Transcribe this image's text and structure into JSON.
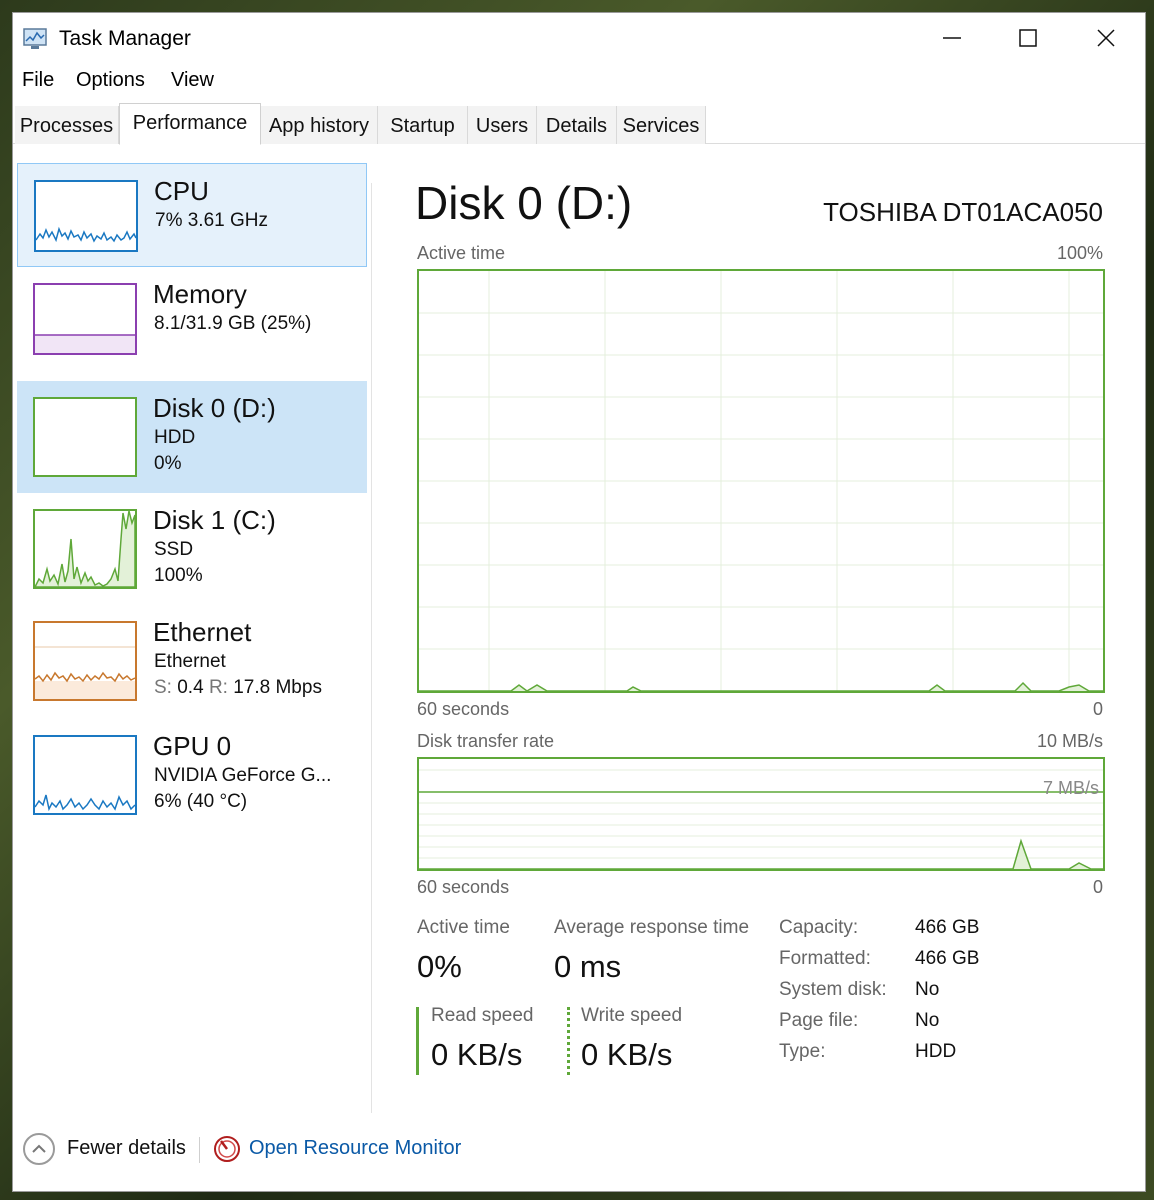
{
  "window": {
    "title": "Task Manager"
  },
  "menu": [
    "File",
    "Options",
    "View"
  ],
  "tabs": [
    "Processes",
    "Performance",
    "App history",
    "Startup",
    "Users",
    "Details",
    "Services"
  ],
  "active_tab": "Performance",
  "sidebar": [
    {
      "name": "CPU",
      "line1": "7%  3.61 GHz"
    },
    {
      "name": "Memory",
      "line1": "8.1/31.9 GB (25%)"
    },
    {
      "name": "Disk 0 (D:)",
      "line1": "HDD",
      "line2": "0%"
    },
    {
      "name": "Disk 1 (C:)",
      "line1": "SSD",
      "line2": "100%"
    },
    {
      "name": "Ethernet",
      "line1": "Ethernet",
      "line2_s_label": "S:",
      "line2_s_val": "0.4",
      "line2_r_label": "R:",
      "line2_r_val": "17.8 Mbps"
    },
    {
      "name": "GPU 0",
      "line1": "NVIDIA GeForce G...",
      "line2": "6%  (40 °C)"
    }
  ],
  "main": {
    "title": "Disk 0 (D:)",
    "device": "TOSHIBA DT01ACA050",
    "graph1": {
      "label": "Active time",
      "max": "100%",
      "time": "60 seconds",
      "min": "0"
    },
    "graph2": {
      "label": "Disk transfer rate",
      "max": "10 MB/s",
      "inner": "7 MB/s",
      "time": "60 seconds",
      "min": "0"
    },
    "stats": {
      "active_time_label": "Active time",
      "active_time": "0%",
      "avg_resp_label": "Average response time",
      "avg_resp": "0 ms",
      "read_label": "Read speed",
      "read": "0 KB/s",
      "write_label": "Write speed",
      "write": "0 KB/s"
    },
    "props": [
      {
        "label": "Capacity:",
        "value": "466 GB"
      },
      {
        "label": "Formatted:",
        "value": "466 GB"
      },
      {
        "label": "System disk:",
        "value": "No"
      },
      {
        "label": "Page file:",
        "value": "No"
      },
      {
        "label": "Type:",
        "value": "HDD"
      }
    ]
  },
  "footer": {
    "fewer": "Fewer details",
    "resource_monitor": "Open Resource Monitor"
  },
  "colors": {
    "disk_green": "#5fa839",
    "cpu_blue": "#1a78c2",
    "memory_purple": "#8b3fb0",
    "ethernet_orange": "#c8782e",
    "link": "#0a59a6"
  }
}
